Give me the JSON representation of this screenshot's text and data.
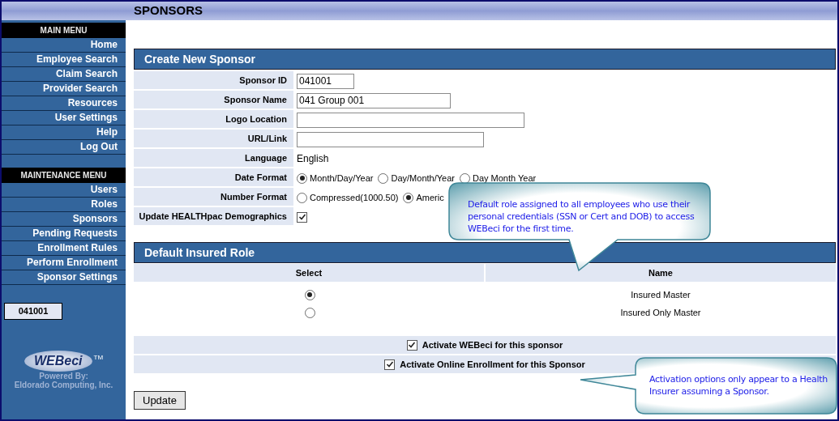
{
  "page_title": "SPONSORS",
  "sidebar": {
    "menus": [
      {
        "heading": "MAIN MENU",
        "items": [
          {
            "label": "Home"
          },
          {
            "label": "Employee Search"
          },
          {
            "label": "Claim Search"
          },
          {
            "label": "Provider Search"
          },
          {
            "label": "Resources"
          },
          {
            "label": "User Settings"
          },
          {
            "label": "Help"
          },
          {
            "label": "Log Out"
          }
        ]
      },
      {
        "heading": "MAINTENANCE MENU",
        "items": [
          {
            "label": "Users"
          },
          {
            "label": "Roles"
          },
          {
            "label": "Sponsors"
          },
          {
            "label": "Pending Requests"
          },
          {
            "label": "Enrollment Rules"
          },
          {
            "label": "Perform Enrollment"
          },
          {
            "label": "Sponsor Settings"
          }
        ]
      }
    ],
    "sponsor_badge": "041001",
    "logo": {
      "text": "WEBeci",
      "trademark": "TM",
      "powered_by": "Powered By:",
      "company": "Eldorado Computing, Inc."
    }
  },
  "form": {
    "title": "Create New Sponsor",
    "fields": [
      {
        "label": "Sponsor ID",
        "kind": "input",
        "value": "041001"
      },
      {
        "label": "Sponsor Name",
        "kind": "input",
        "value": "041 Group 001"
      },
      {
        "label": "Logo Location",
        "kind": "input"
      },
      {
        "label": "URL/Link",
        "kind": "input"
      },
      {
        "label": "Language",
        "kind": "text",
        "value": "English"
      },
      {
        "label": "Date Format",
        "kind": "radio",
        "options": [
          {
            "label": "Month/Day/Year",
            "selected": true
          },
          {
            "label": "Day/Month/Year",
            "selected": false
          },
          {
            "label": "Day Month Year",
            "selected": false
          }
        ]
      },
      {
        "label": "Number Format",
        "kind": "radio",
        "options": [
          {
            "label": "Compressed(1000.50)",
            "selected": false
          },
          {
            "label": "Americ",
            "selected": true
          }
        ]
      },
      {
        "label": "Update HEALTHpac Demographics",
        "kind": "checkbox",
        "checked": true
      }
    ]
  },
  "insured_role": {
    "title": "Default Insured Role",
    "columns": [
      "Select",
      "Name"
    ],
    "rows": [
      {
        "name": "Insured Master",
        "selected": true
      },
      {
        "name": "Insured Only Master",
        "selected": false
      }
    ]
  },
  "activations": [
    {
      "label": "Activate WEBeci for this sponsor",
      "checked": true
    },
    {
      "label": "Activate Online Enrollment for this Sponsor",
      "checked": true
    }
  ],
  "update_button": "Update",
  "callouts": [
    {
      "text": "Default role assigned to all employees who use their personal credentials (SSN or Cert and DOB) to access WEBeci for the first time."
    },
    {
      "text": "Activation options only appear to a Health Insurer assuming a Sponsor."
    }
  ]
}
